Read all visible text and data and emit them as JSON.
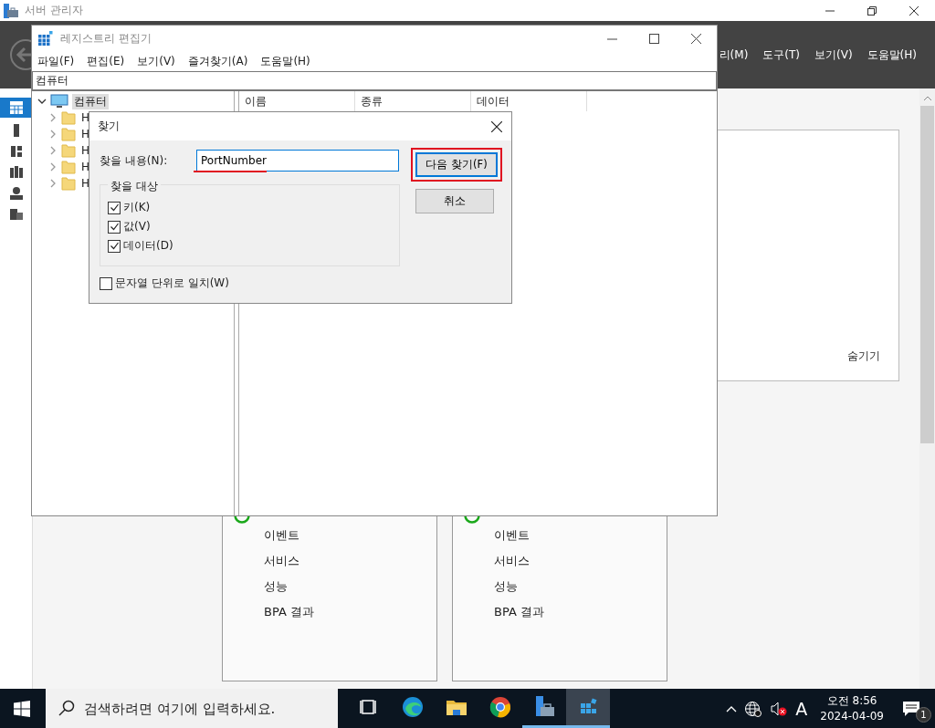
{
  "server_manager": {
    "title": "서버 관리자",
    "menu": [
      "리(M)",
      "도구(T)",
      "보기(V)",
      "도움말(H)"
    ],
    "sidebar_items": [
      {
        "selected": true
      },
      {
        "selected": false
      },
      {
        "selected": false
      },
      {
        "selected": false
      },
      {
        "selected": false
      },
      {
        "selected": false
      }
    ],
    "panel": {
      "hide_link": "숨기기"
    },
    "tiles": [
      {
        "items": [
          "이벤트",
          "서비스",
          "성능",
          "BPA 결과"
        ]
      },
      {
        "items": [
          "이벤트",
          "서비스",
          "성능",
          "BPA 결과"
        ]
      }
    ]
  },
  "registry_editor": {
    "title": "레지스트리 편집기",
    "menu": [
      "파일(F)",
      "편집(E)",
      "보기(V)",
      "즐겨찾기(A)",
      "도움말(H)"
    ],
    "address": "컴퓨터",
    "tree": {
      "label": "컴퓨터",
      "expanded": true,
      "selected": true,
      "children": [
        {
          "label": "H"
        },
        {
          "label": "H"
        },
        {
          "label": "H"
        },
        {
          "label": "H"
        },
        {
          "label": "H"
        }
      ]
    },
    "columns": [
      "이름",
      "종류",
      "데이터"
    ]
  },
  "find_dialog": {
    "title": "찾기",
    "find_label": "찾을 내용(N):",
    "value": "PortNumber",
    "value_underlined": true,
    "find_next": "다음 찾기(F)",
    "find_next_highlighted": true,
    "cancel": "취소",
    "look_at": "찾을 대상",
    "options": [
      {
        "label": "키(K)",
        "checked": true
      },
      {
        "label": "값(V)",
        "checked": true
      },
      {
        "label": "데이터(D)",
        "checked": true
      }
    ],
    "match_whole": {
      "label": "문자열 단위로 일치(W)",
      "checked": false
    }
  },
  "taskbar": {
    "search_placeholder": "검색하려면 여기에 입력하세요.",
    "apps": [
      {
        "kind": "task-view",
        "running": false,
        "active": false
      },
      {
        "kind": "edge",
        "running": false,
        "active": false
      },
      {
        "kind": "folder",
        "running": false,
        "active": false
      },
      {
        "kind": "chrome",
        "running": false,
        "active": false
      },
      {
        "kind": "server-manager",
        "running": true,
        "active": false
      },
      {
        "kind": "registry",
        "running": true,
        "active": true
      }
    ],
    "ime": "A",
    "time": "오전 8:56",
    "date": "2024-04-09",
    "notification_count": "1"
  }
}
